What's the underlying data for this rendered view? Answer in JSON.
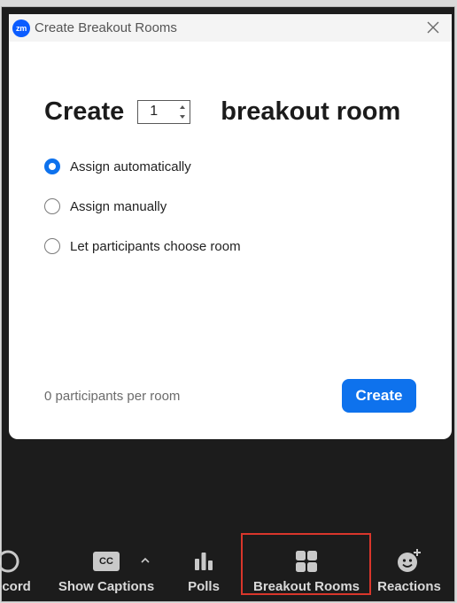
{
  "window": {
    "logo_text": "zm",
    "title": "Create Breakout Rooms"
  },
  "dialog": {
    "create_word": "Create",
    "room_count": "1",
    "room_word": "breakout room",
    "options": [
      {
        "label": "Assign automatically",
        "selected": true
      },
      {
        "label": "Assign manually",
        "selected": false
      },
      {
        "label": "Let participants choose room",
        "selected": false
      }
    ],
    "participants_per_room": "0 participants per room",
    "create_button": "Create"
  },
  "toolbar": {
    "items": [
      {
        "label": "Record",
        "icon": "record-icon"
      },
      {
        "label": "Show Captions",
        "icon": "cc-icon",
        "icon_text": "CC"
      },
      {
        "label": "Polls",
        "icon": "polls-icon"
      },
      {
        "label": "Breakout Rooms",
        "icon": "breakout-rooms-icon",
        "highlighted": true
      },
      {
        "label": "Reactions",
        "icon": "reactions-icon"
      }
    ]
  },
  "colors": {
    "accent": "#0e72ed",
    "highlight": "#d9362b",
    "toolbar_bg": "#1c1c1c"
  }
}
